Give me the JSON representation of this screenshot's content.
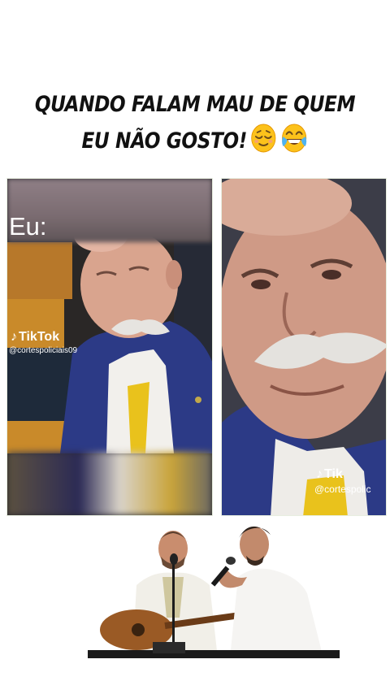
{
  "caption": {
    "line1": "QUANDO FALAM MAU DE QUEM",
    "line2": "EU NÃO GOSTO!"
  },
  "emojis": [
    "relieved-face",
    "face-with-tears-of-joy"
  ],
  "left_panel": {
    "overlay_text": "Eu:",
    "tiktok_label": "TikTok",
    "tiktok_handle": "@cortespoliciais09"
  },
  "right_panel": {
    "tiktok_label": "Tik",
    "tiktok_handle": "@cortespolic"
  },
  "colors": {
    "caption_text": "#111111",
    "suit_blue": "#2c3a86",
    "tie_yellow": "#e9c21c",
    "wall_orange": "#c98a2a"
  }
}
